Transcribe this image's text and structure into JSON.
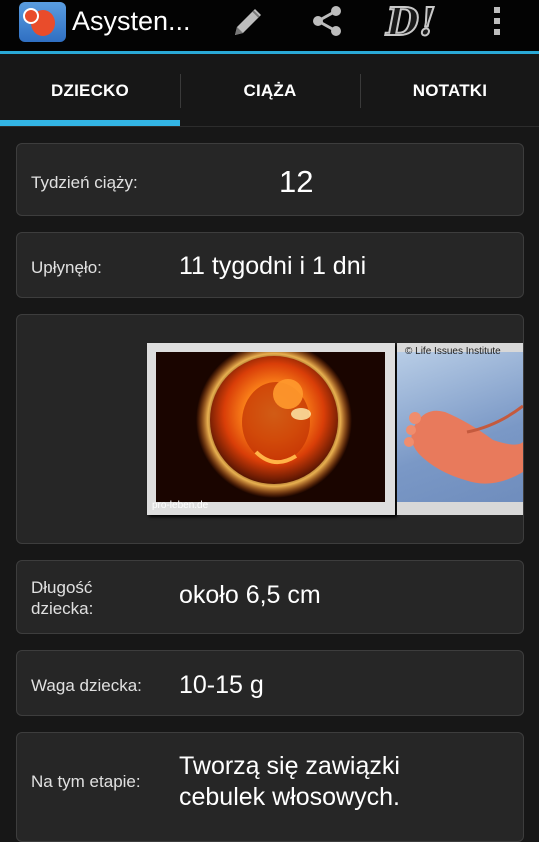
{
  "app": {
    "title": "Asysten...",
    "icons": [
      "app-icon",
      "pencil-icon",
      "share-icon",
      "di-logo-icon",
      "overflow-menu-icon"
    ],
    "di_logo_text": "D!"
  },
  "tabs": [
    {
      "label": "DZIECKO",
      "selected": true
    },
    {
      "label": "CIĄŻA",
      "selected": false
    },
    {
      "label": "NOTATKI",
      "selected": false
    }
  ],
  "info": {
    "week": {
      "label": "Tydzień ciąży:",
      "value": "12"
    },
    "elapsed": {
      "label": "Upłynęło:",
      "value": "11 tygodni i 1 dni"
    },
    "length": {
      "label_line1": "Długość",
      "label_line2": "dziecka:",
      "value": "około 6,5 cm"
    },
    "weight": {
      "label": "Waga dziecka:",
      "value": "10-15 g"
    },
    "stage": {
      "label": "Na tym etapie:",
      "value_line1": "Tworzą się zawiązki",
      "value_line2": "cebulek włosowych."
    }
  },
  "gallery": {
    "image1_watermark": "pro-leben.de",
    "image2_credit": "© Life Issues Institute"
  },
  "colors": {
    "accent": "#33b5e5",
    "background": "#171717",
    "card": "#262626"
  }
}
